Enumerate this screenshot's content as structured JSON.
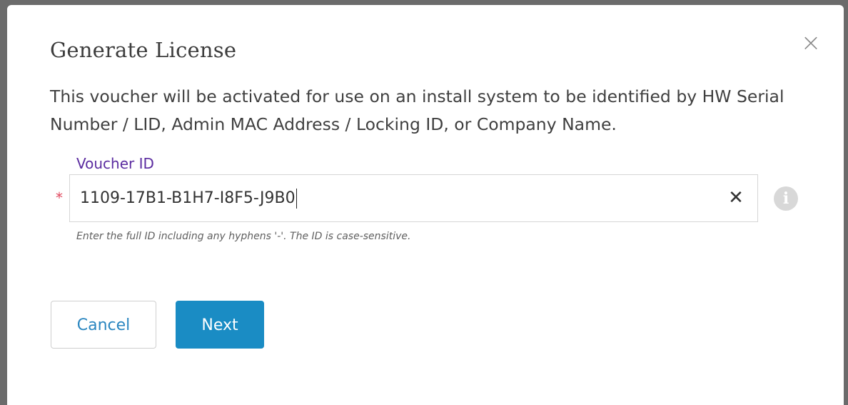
{
  "dialog": {
    "title": "Generate License",
    "close_glyph": "×",
    "description": "This voucher will be activated for use on an install system to be identified by HW Serial Number / LID, Admin MAC Address / Locking ID, or Company Name."
  },
  "voucher_field": {
    "label": "Voucher ID",
    "required_marker": "*",
    "value": "1109-17B1-B1H7-I8F5-J9B0",
    "clear_glyph": "✕",
    "info_glyph": "i",
    "hint": "Enter the full ID including any hyphens '-'. The ID is case-sensitive."
  },
  "buttons": {
    "cancel_label": "Cancel",
    "next_label": "Next"
  },
  "icons": {
    "close": "close-icon",
    "clear": "clear-input-icon",
    "info": "info-icon"
  },
  "colors": {
    "label_purple": "#5b2ca0",
    "required_red": "#e0485e",
    "primary_blue": "#1a8cc4",
    "link_blue": "#2a86c0"
  }
}
